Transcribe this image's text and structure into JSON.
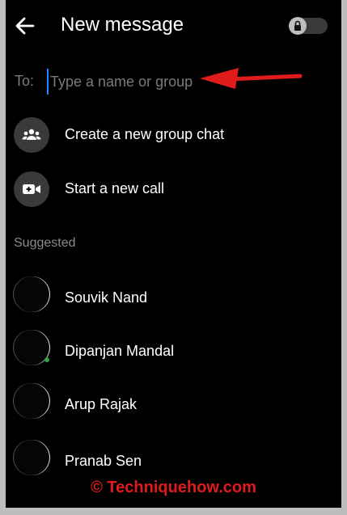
{
  "header": {
    "title": "New message",
    "back_icon": "arrow-left-icon",
    "lock_icon": "lock-icon"
  },
  "recipient": {
    "label": "To:",
    "placeholder": "Type a name or group"
  },
  "actions": [
    {
      "label": "Create a new group chat",
      "icon": "group-icon"
    },
    {
      "label": "Start a new call",
      "icon": "video-camera-icon"
    }
  ],
  "suggested": {
    "label": "Suggested",
    "contacts": [
      {
        "name": "Souvik Nand"
      },
      {
        "name": "Dipanjan Mandal"
      },
      {
        "name": "Arup Rajak"
      },
      {
        "name": "Pranab Sen"
      }
    ]
  },
  "watermark": "© Techniquehow.com",
  "colors": {
    "background": "#000000",
    "cursor": "#1e8bff",
    "annotation_arrow": "#e01b1b",
    "watermark": "#e01b1b",
    "online_dot": "#31a24c"
  }
}
